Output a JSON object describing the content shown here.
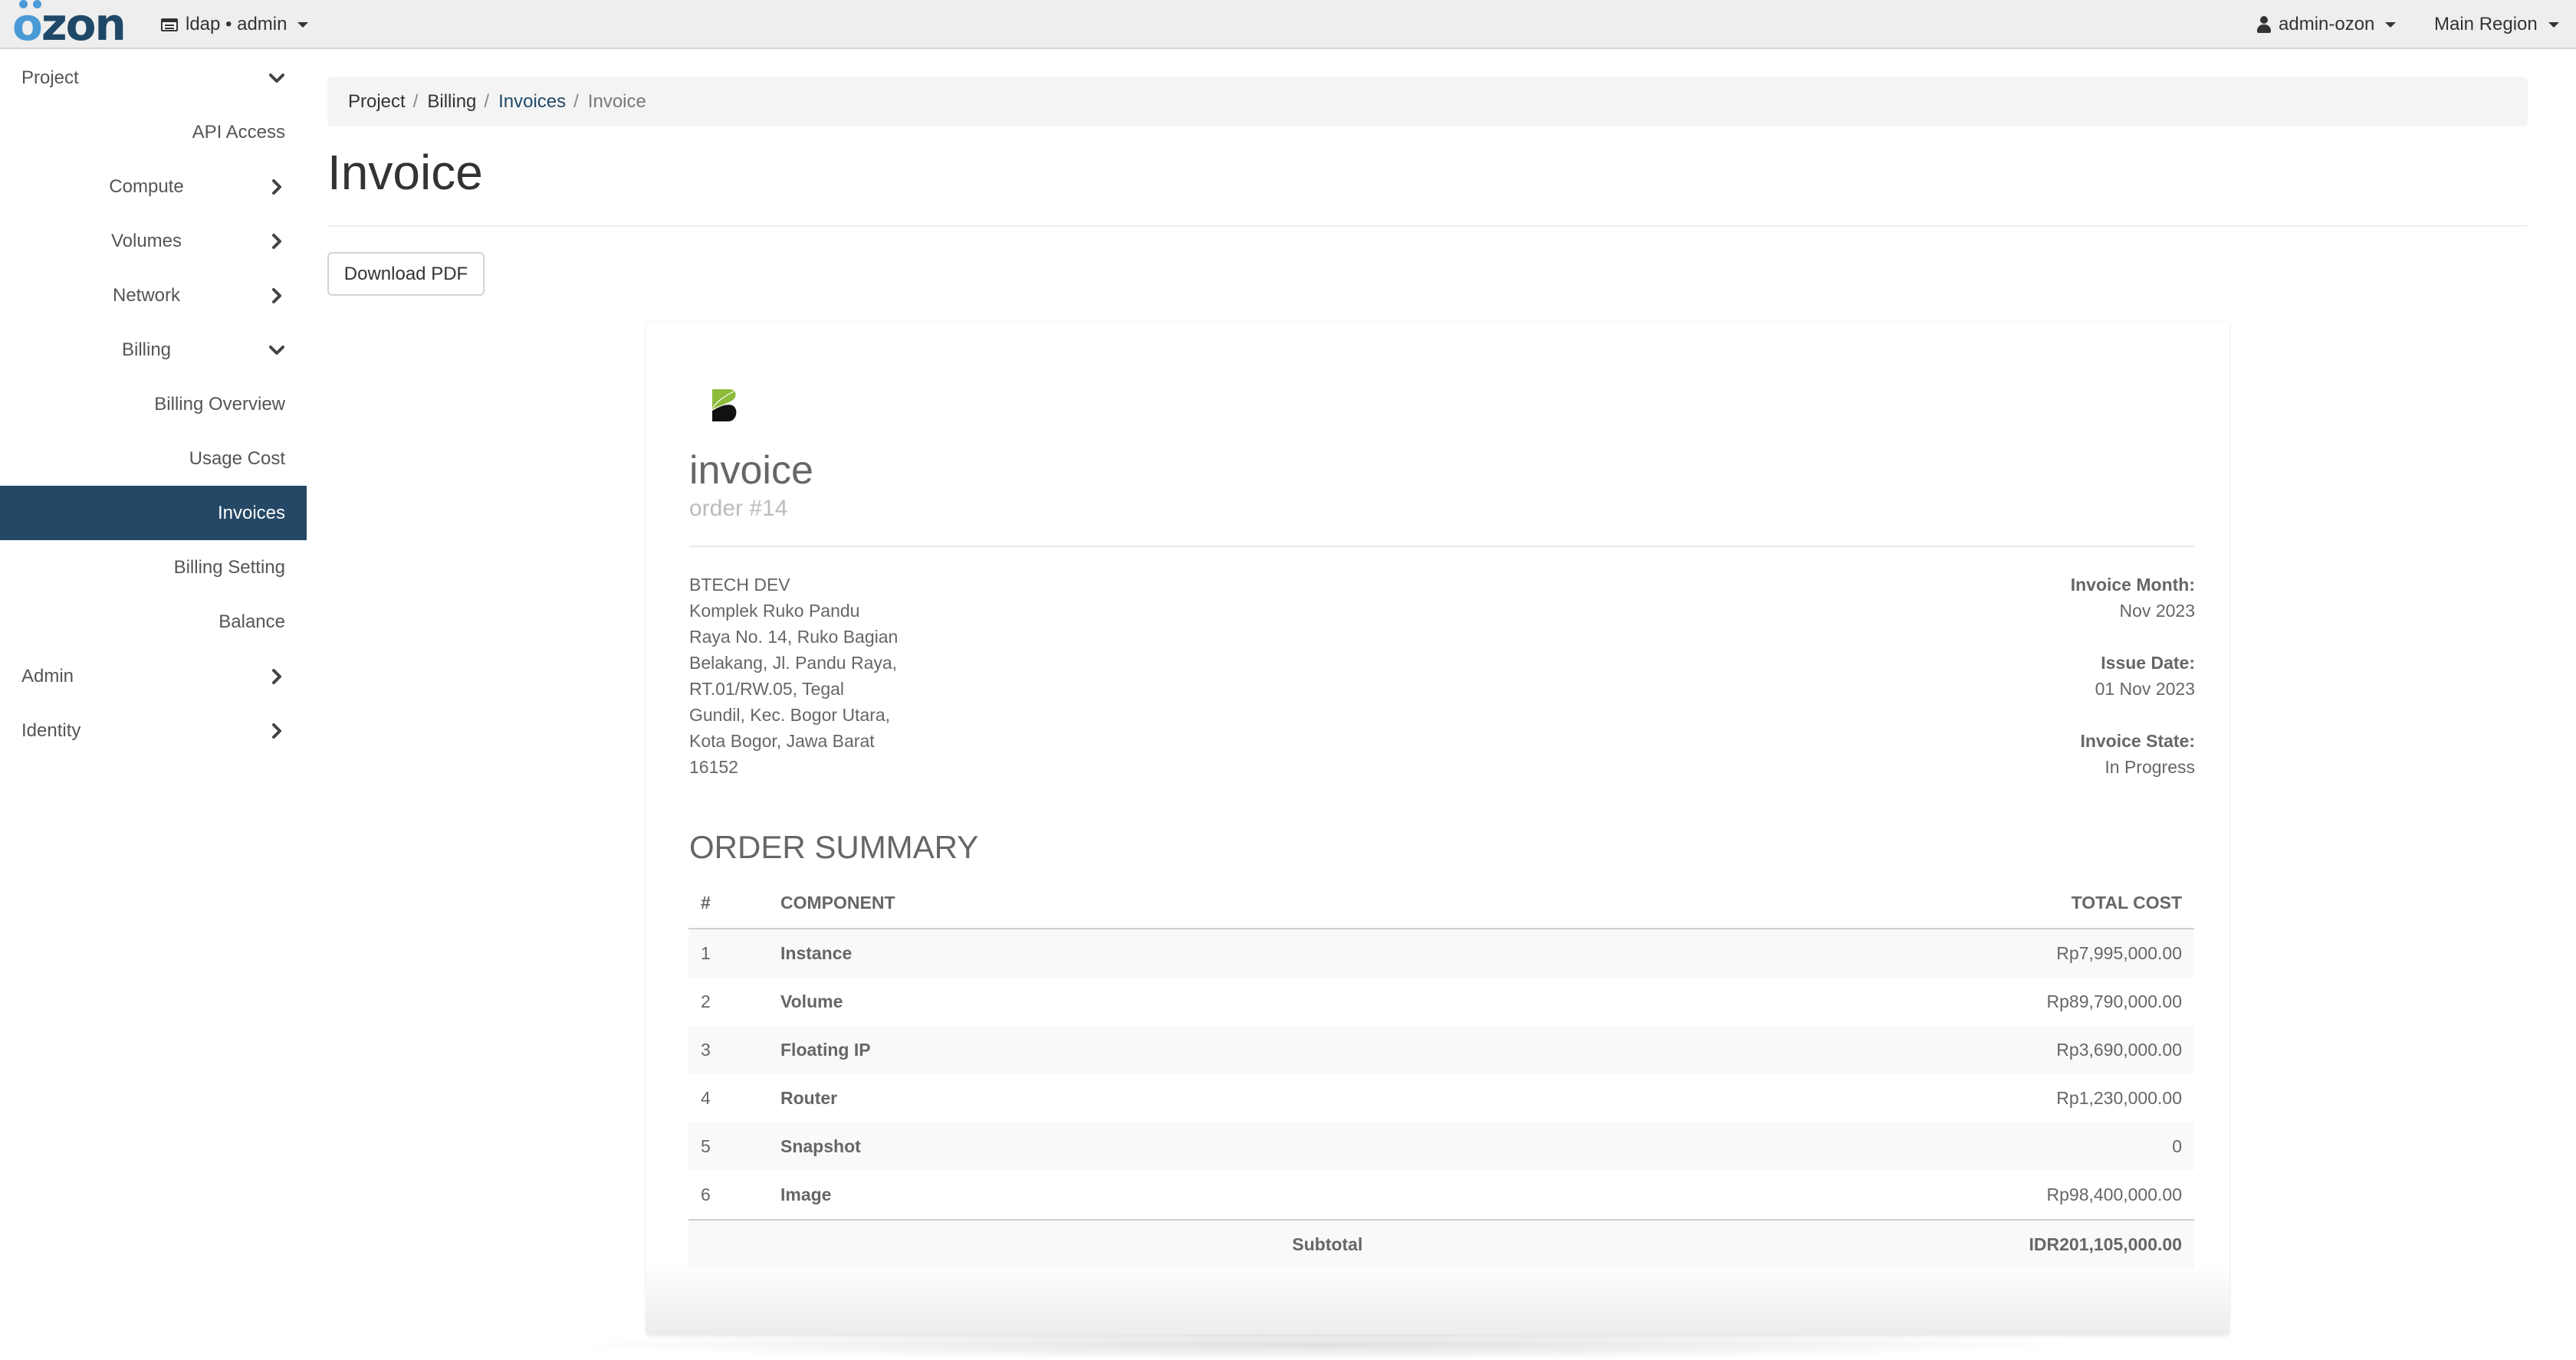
{
  "topbar": {
    "logo": {
      "first_letter": "o",
      "rest": "zon"
    },
    "context": {
      "label": "ldap • admin",
      "icon": "project-list-icon"
    },
    "user": {
      "label": "admin-ozon",
      "icon": "user-icon"
    },
    "region": {
      "label": "Main Region"
    }
  },
  "sidebar": {
    "items": [
      {
        "label": "Project",
        "level": 0,
        "chevron": "down"
      },
      {
        "label": "API Access",
        "level": 1,
        "chevron": null
      },
      {
        "label": "Compute",
        "level": 1,
        "chevron": "right"
      },
      {
        "label": "Volumes",
        "level": 1,
        "chevron": "right"
      },
      {
        "label": "Network",
        "level": 1,
        "chevron": "right"
      },
      {
        "label": "Billing",
        "level": 1,
        "chevron": "down"
      },
      {
        "label": "Billing Overview",
        "level": 2,
        "chevron": null
      },
      {
        "label": "Usage Cost",
        "level": 2,
        "chevron": null
      },
      {
        "label": "Invoices",
        "level": 2,
        "chevron": null,
        "active": true
      },
      {
        "label": "Billing Setting",
        "level": 2,
        "chevron": null
      },
      {
        "label": "Balance",
        "level": 2,
        "chevron": null
      },
      {
        "label": "Admin",
        "level": 0,
        "chevron": "right"
      },
      {
        "label": "Identity",
        "level": 0,
        "chevron": "right"
      }
    ],
    "active_color": "#244866"
  },
  "breadcrumb": [
    {
      "label": "Project",
      "type": "plain"
    },
    {
      "label": "Billing",
      "type": "plain"
    },
    {
      "label": "Invoices",
      "type": "link"
    },
    {
      "label": "Invoice",
      "type": "current"
    }
  ],
  "page": {
    "title": "Invoice",
    "download_button": "Download PDF"
  },
  "invoice": {
    "title": "invoice",
    "order": "order #14",
    "address_lines": [
      "BTECH DEV",
      "Komplek Ruko Pandu",
      "Raya No. 14, Ruko Bagian",
      "Belakang, Jl. Pandu Raya,",
      "RT.01/RW.05, Tegal",
      "Gundil, Kec. Bogor Utara,",
      "Kota Bogor, Jawa Barat",
      "16152"
    ],
    "meta": [
      {
        "label": "Invoice Month:",
        "value": "Nov 2023"
      },
      {
        "label": "Issue Date:",
        "value": "01 Nov 2023"
      },
      {
        "label": "Invoice State:",
        "value": "In Progress"
      }
    ],
    "summary_title": "ORDER SUMMARY",
    "columns": {
      "num": "#",
      "component": "COMPONENT",
      "cost": "TOTAL COST"
    },
    "rows": [
      {
        "num": "1",
        "component": "Instance",
        "cost": "Rp7,995,000.00"
      },
      {
        "num": "2",
        "component": "Volume",
        "cost": "Rp89,790,000.00"
      },
      {
        "num": "3",
        "component": "Floating IP",
        "cost": "Rp3,690,000.00"
      },
      {
        "num": "4",
        "component": "Router",
        "cost": "Rp1,230,000.00"
      },
      {
        "num": "5",
        "component": "Snapshot",
        "cost": "0"
      },
      {
        "num": "6",
        "component": "Image",
        "cost": "Rp98,400,000.00"
      }
    ],
    "subtotal_label": "Subtotal",
    "subtotal_value": "IDR201,105,000.00"
  }
}
